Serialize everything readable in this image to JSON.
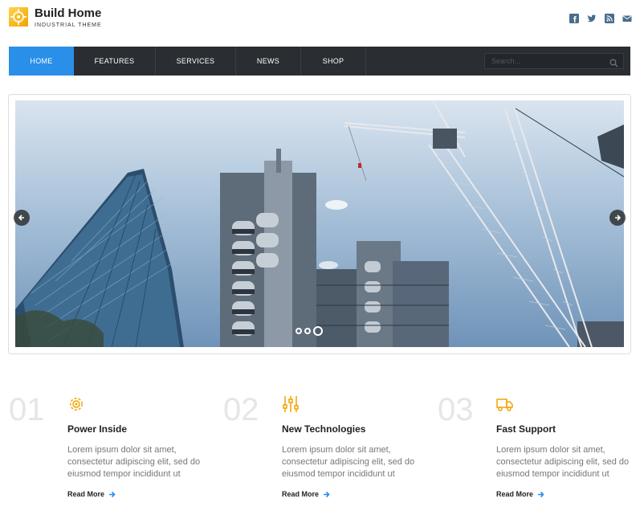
{
  "brand": {
    "title": "Build Home",
    "subtitle": "INDUSTRIAL THEME",
    "accent": "#f2a300"
  },
  "social": [
    "facebook-icon",
    "twitter-icon",
    "rss-icon",
    "mail-icon"
  ],
  "nav": {
    "items": [
      {
        "label": "HOME",
        "active": true
      },
      {
        "label": "FEATURES",
        "active": false
      },
      {
        "label": "SERVICES",
        "active": false
      },
      {
        "label": "NEWS",
        "active": false
      },
      {
        "label": "SHOP",
        "active": false
      }
    ],
    "search_placeholder": "Search...",
    "active_color": "#2a8fe8",
    "bar_color": "#2a2d31"
  },
  "slider": {
    "image": "construction-cranes-skyscrapers",
    "dots_total": 3,
    "dot_active": 3
  },
  "features": [
    {
      "number": "01",
      "icon": "gear-icon",
      "title": "Power Inside",
      "text": "Lorem ipsum dolor sit amet, consectetur adipiscing elit, sed do eiusmod tempor incididunt ut",
      "link": "Read More"
    },
    {
      "number": "02",
      "icon": "sliders-icon",
      "title": "New Technologies",
      "text": "Lorem ipsum dolor sit amet, consectetur adipiscing elit, sed do eiusmod tempor incididunt ut",
      "link": "Read More"
    },
    {
      "number": "03",
      "icon": "truck-icon",
      "title": "Fast Support",
      "text": "Lorem ipsum dolor sit amet, consectetur adipiscing elit, sed do eiusmod tempor incididunt ut",
      "link": "Read More"
    }
  ]
}
